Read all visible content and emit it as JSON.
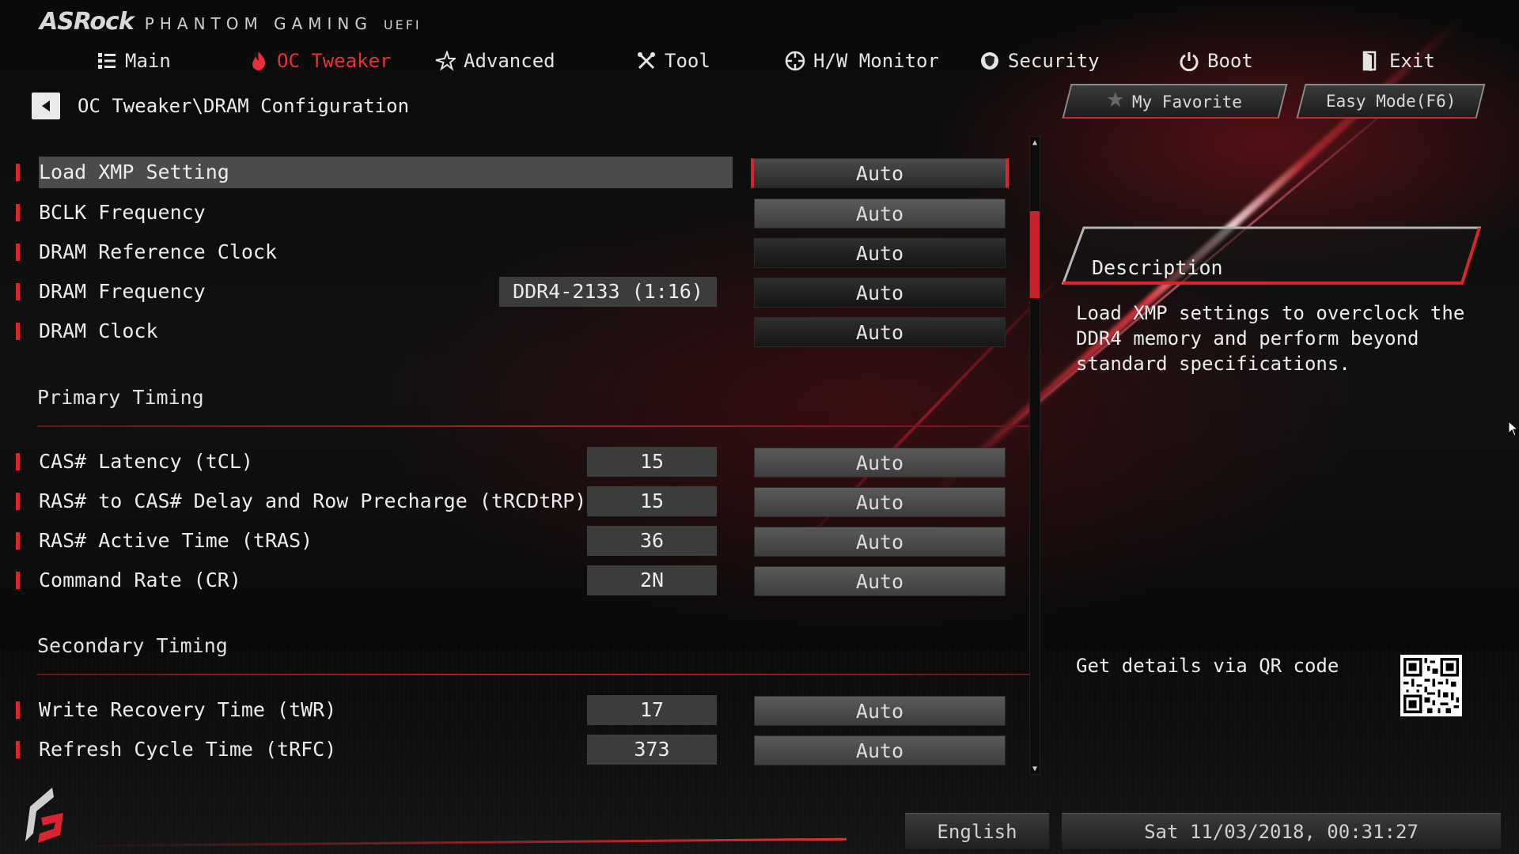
{
  "header": {
    "brand": "ASRock",
    "product": "PHANTOM GAMING",
    "uefi": "UEFI"
  },
  "nav": [
    {
      "label": "Main",
      "icon": "list-icon",
      "active": false
    },
    {
      "label": "OC Tweaker",
      "icon": "flame-icon",
      "active": true
    },
    {
      "label": "Advanced",
      "icon": "star-icon",
      "active": false
    },
    {
      "label": "Tool",
      "icon": "wrench-icon",
      "active": false
    },
    {
      "label": "H/W Monitor",
      "icon": "crosshair-icon",
      "active": false
    },
    {
      "label": "Security",
      "icon": "shield-icon",
      "active": false
    },
    {
      "label": "Boot",
      "icon": "power-icon",
      "active": false
    },
    {
      "label": "Exit",
      "icon": "exit-door-icon",
      "active": false
    }
  ],
  "breadcrumb": "OC Tweaker\\DRAM Configuration",
  "buttons": {
    "favorite": "My Favorite",
    "easy_mode": "Easy Mode(F6)"
  },
  "settings_top": [
    {
      "label": "Load XMP Setting",
      "readout": "",
      "value": "Auto",
      "selected": true
    },
    {
      "label": "BCLK Frequency",
      "readout": "",
      "value": "Auto"
    },
    {
      "label": "DRAM Reference Clock",
      "readout": "",
      "value": "Auto"
    },
    {
      "label": "DRAM Frequency",
      "readout": "DDR4-2133 (1:16)",
      "value": "Auto"
    },
    {
      "label": "DRAM Clock",
      "readout": "",
      "value": "Auto"
    }
  ],
  "primary_timing": {
    "title": "Primary Timing",
    "items": [
      {
        "label": "CAS# Latency (tCL)",
        "readout": "15",
        "value": "Auto"
      },
      {
        "label": "RAS# to CAS# Delay and Row Precharge (tRCDtRP)",
        "readout": "15",
        "value": "Auto"
      },
      {
        "label": "RAS# Active Time (tRAS)",
        "readout": "36",
        "value": "Auto"
      },
      {
        "label": "Command Rate (CR)",
        "readout": "2N",
        "value": "Auto"
      }
    ]
  },
  "secondary_timing": {
    "title": "Secondary Timing",
    "items": [
      {
        "label": "Write Recovery Time (tWR)",
        "readout": "17",
        "value": "Auto"
      },
      {
        "label": "Refresh Cycle Time (tRFC)",
        "readout": "373",
        "value": "Auto"
      }
    ]
  },
  "description": {
    "title": "Description",
    "text": "Load XMP settings to overclock the DDR4 memory and perform beyond standard specifications."
  },
  "qr_label": "Get details via QR code",
  "footer": {
    "language": "English",
    "datetime": "Sat 11/03/2018, 00:31:27"
  },
  "colors": {
    "accent": "#d8252f",
    "active_tab": "#e8303a",
    "background": "#050505"
  },
  "scroll_position": 0.12
}
